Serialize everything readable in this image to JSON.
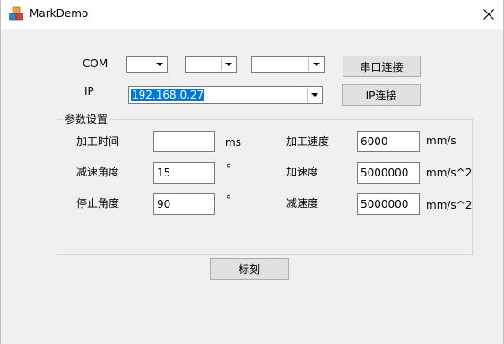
{
  "window": {
    "title": "MarkDemo",
    "close_glyph": "✕"
  },
  "com": {
    "label": "COM",
    "combo1_value": "",
    "combo2_value": "",
    "combo3_value": "",
    "connect_button": "串口连接"
  },
  "ip": {
    "label": "IP",
    "value": "192.168.0.27",
    "connect_button": "IP连接"
  },
  "params": {
    "group_title": "参数设置",
    "process_time_label": "加工时间",
    "process_time_value": "",
    "process_time_unit": "ms",
    "process_speed_label": "加工速度",
    "process_speed_value": "6000",
    "process_speed_unit": "mm/s",
    "decel_angle_label": "减速角度",
    "decel_angle_value": "15",
    "decel_angle_unit": "°",
    "accel_label": "加速度",
    "accel_value": "5000000",
    "accel_unit": "mm/s^2",
    "stop_angle_label": "停止角度",
    "stop_angle_value": "90",
    "stop_angle_unit": "°",
    "decel_label": "减速度",
    "decel_value": "5000000",
    "decel_unit": "mm/s^2"
  },
  "mark_button": "标刻",
  "icons": {
    "app": "app-cube-icon",
    "close": "close-icon",
    "dropdown": "chevron-down-icon"
  }
}
